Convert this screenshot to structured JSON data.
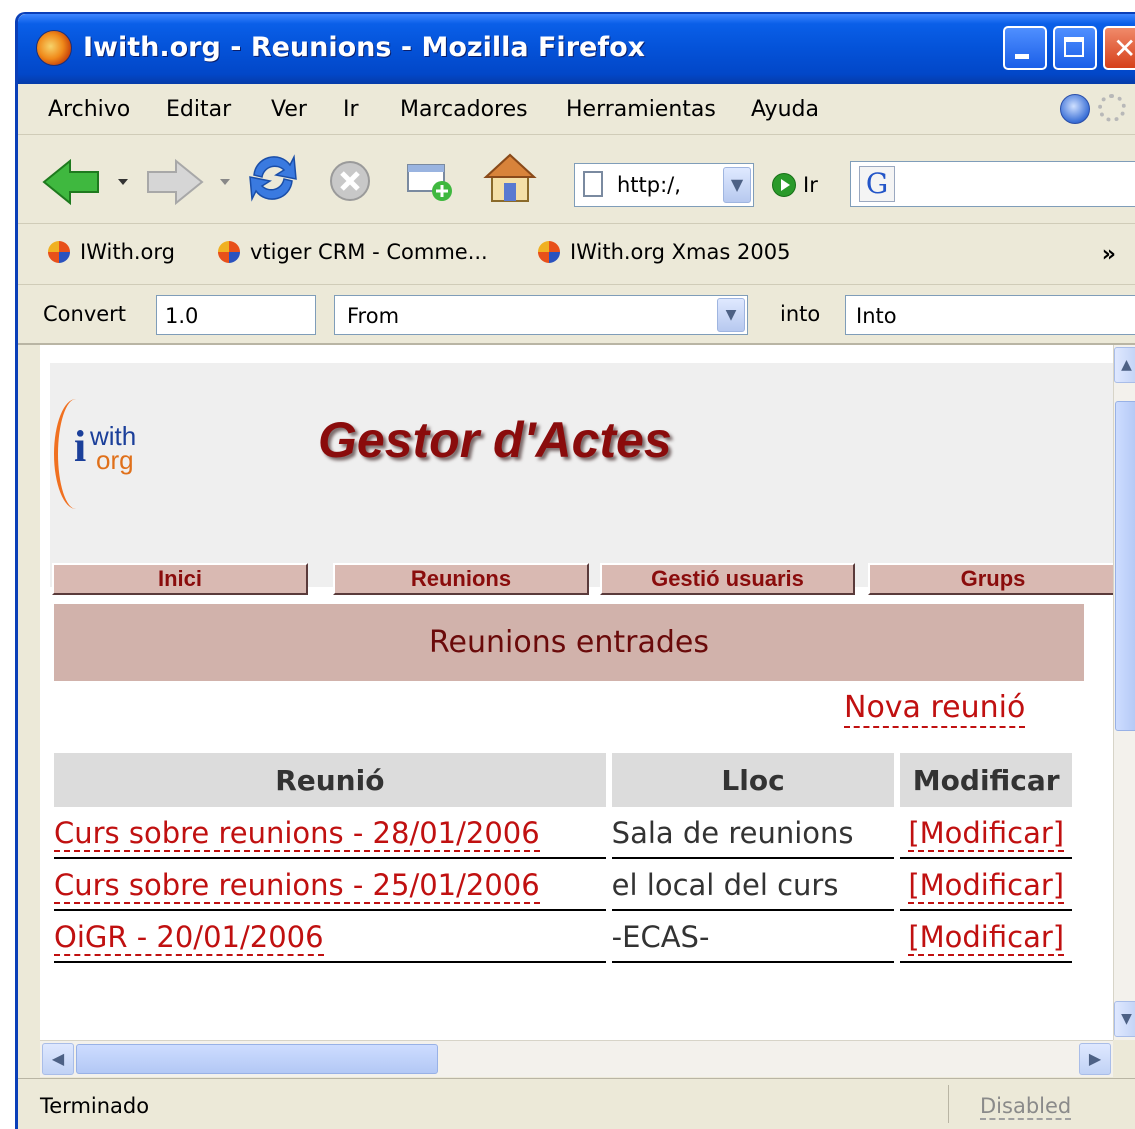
{
  "window": {
    "title": "Iwith.org - Reunions - Mozilla Firefox"
  },
  "menu": {
    "items": [
      "Archivo",
      "Editar",
      "Ver",
      "Ir",
      "Marcadores",
      "Herramientas",
      "Ayuda"
    ]
  },
  "navbar": {
    "url": "http:/,",
    "go_label": "Ir",
    "search_engine_label": "G"
  },
  "bookmarks": {
    "items": [
      "IWith.org",
      "vtiger CRM - Comme...",
      "IWith.org Xmas 2005"
    ],
    "more": "»"
  },
  "convert": {
    "label": "Convert",
    "amount": "1.0",
    "from_placeholder": "From",
    "into_label": "into",
    "into_placeholder": "Into"
  },
  "page": {
    "logo_i": "i",
    "logo_with": "with",
    "logo_org": "org",
    "site_title": "Gestor d'Actes",
    "tabs": [
      "Inici",
      "Reunions",
      "Gestió usuaris",
      "Grups"
    ],
    "section_title": "Reunions entrades",
    "new_link": "Nova reunió",
    "table": {
      "headers": [
        "Reunió",
        "Lloc",
        "Modificar"
      ],
      "rows": [
        {
          "meeting": "Curs sobre reunions - 28/01/2006",
          "place": "Sala de reunions",
          "action": "[Modificar]"
        },
        {
          "meeting": "Curs sobre reunions - 25/01/2006",
          "place": "el local del curs",
          "action": "[Modificar]"
        },
        {
          "meeting": "OiGR - 20/01/2006",
          "place": "-ECAS-",
          "action": "[Modificar]"
        }
      ]
    }
  },
  "status": {
    "text": "Terminado",
    "right": "Disabled"
  },
  "colors": {
    "titlebar": "#0452d8",
    "accent_red": "#8a0c0c",
    "link_red": "#c01010",
    "tab_bg": "#d9b9b2",
    "section_bg": "#d1b2ab"
  }
}
